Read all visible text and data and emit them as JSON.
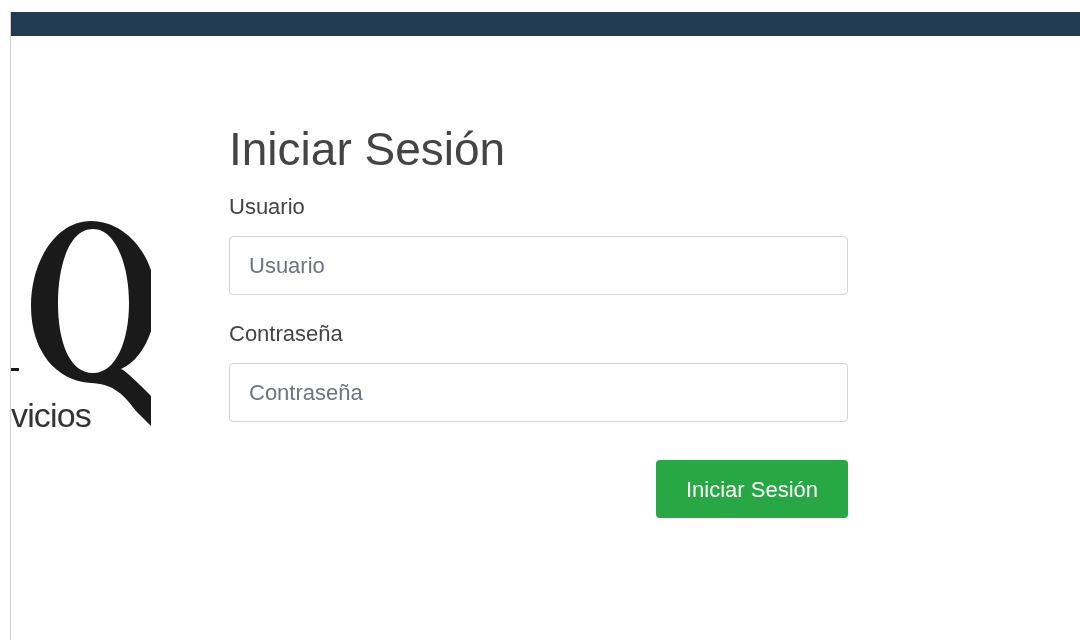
{
  "logo": {
    "tagline": "vicios"
  },
  "form": {
    "title": "Iniciar Sesión",
    "fields": [
      {
        "label": "Usuario",
        "placeholder": "Usuario"
      },
      {
        "label": "Contraseña",
        "placeholder": "Contraseña"
      }
    ],
    "submit": "Iniciar Sesión"
  }
}
